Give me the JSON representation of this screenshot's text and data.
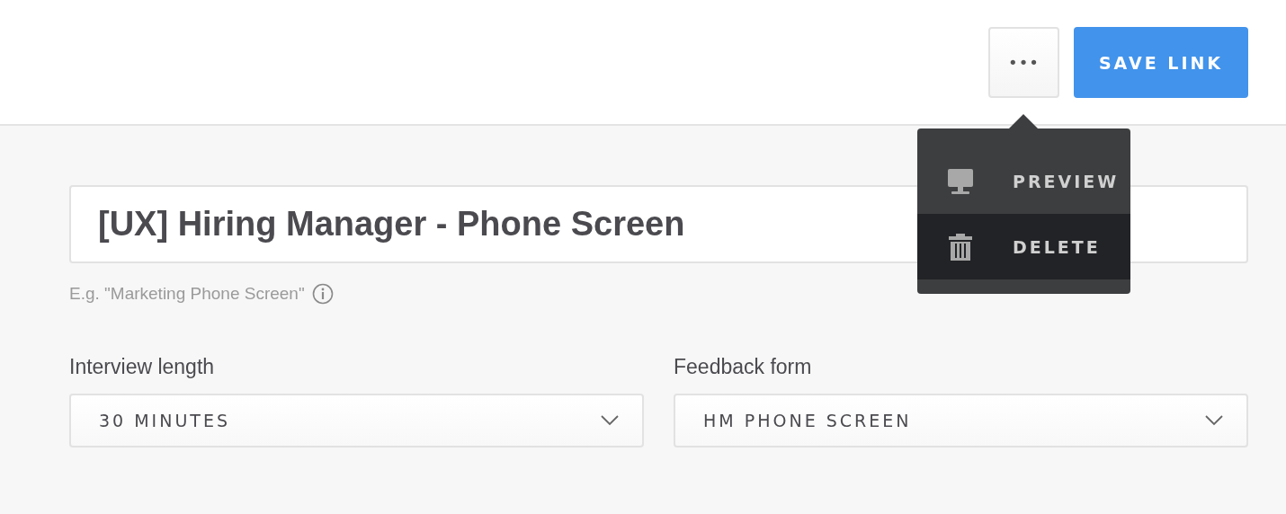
{
  "header": {
    "more_button": {
      "label": "•••"
    },
    "save_button": {
      "label": "SAVE LINK"
    }
  },
  "menu": {
    "items": [
      {
        "kind": "preview",
        "label": "PREVIEW",
        "selected": false
      },
      {
        "kind": "delete",
        "label": "DELETE",
        "selected": true
      }
    ]
  },
  "name_field": {
    "value": "[UX] Hiring Manager - Phone Screen",
    "hint": "E.g. \"Marketing Phone Screen\""
  },
  "selects": [
    {
      "label": "Interview length",
      "value": "30 MINUTES"
    },
    {
      "label": "Feedback form",
      "value": "HM PHONE SCREEN"
    }
  ]
}
